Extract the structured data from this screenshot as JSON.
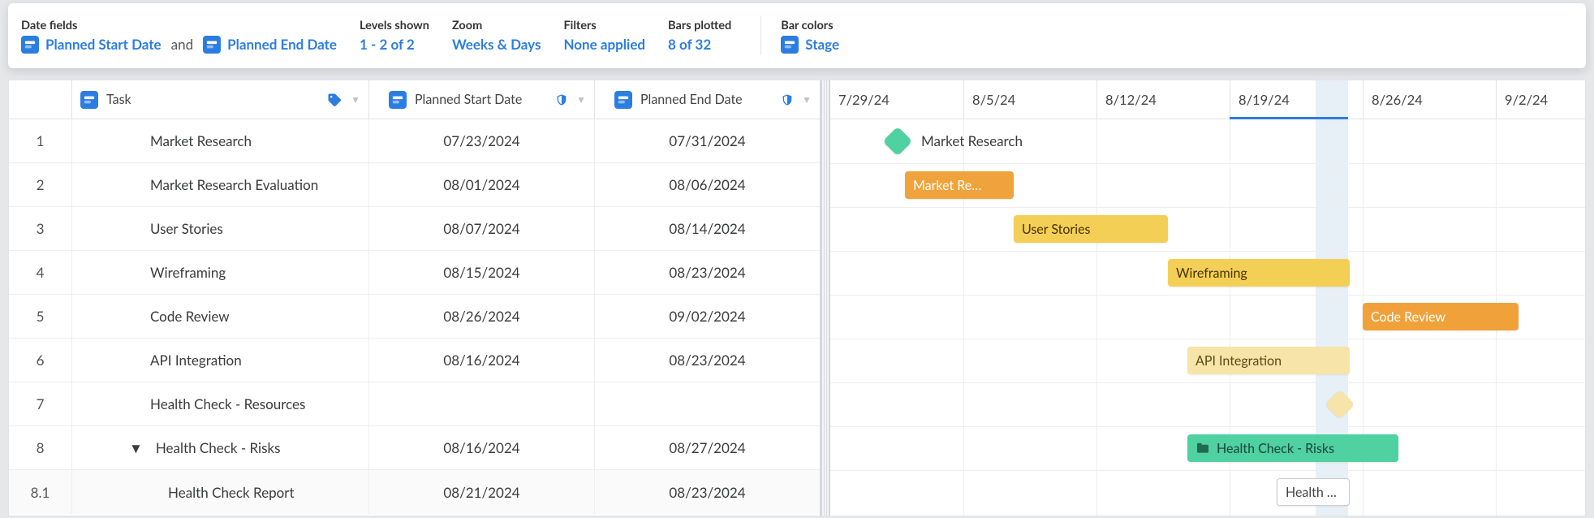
{
  "toolbar": {
    "date_fields": {
      "label": "Date fields",
      "start": "Planned Start Date",
      "and": "and",
      "end": "Planned End Date"
    },
    "levels": {
      "label": "Levels shown",
      "value": "1 - 2 of 2"
    },
    "zoom": {
      "label": "Zoom",
      "value": "Weeks & Days"
    },
    "filters": {
      "label": "Filters",
      "value": "None applied"
    },
    "bars": {
      "label": "Bars plotted",
      "value": "8 of 32"
    },
    "colors": {
      "label": "Bar colors",
      "value": "Stage"
    }
  },
  "columns": {
    "task": "Task",
    "start": "Planned Start Date",
    "end": "Planned End Date"
  },
  "timeline": {
    "ticks": [
      "7/29/24",
      "8/5/24",
      "8/12/24",
      "8/19/24",
      "8/26/24",
      "9/2/24"
    ]
  },
  "rows": [
    {
      "num": "1",
      "task": "Market Research",
      "start": "07/23/2024",
      "end": "07/31/2024",
      "indent": 0
    },
    {
      "num": "2",
      "task": "Market Research Evaluation",
      "start": "08/01/2024",
      "end": "08/06/2024",
      "indent": 0
    },
    {
      "num": "3",
      "task": "User Stories",
      "start": "08/07/2024",
      "end": "08/14/2024",
      "indent": 0
    },
    {
      "num": "4",
      "task": "Wireframing",
      "start": "08/15/2024",
      "end": "08/23/2024",
      "indent": 0
    },
    {
      "num": "5",
      "task": "Code Review",
      "start": "08/26/2024",
      "end": "09/02/2024",
      "indent": 0
    },
    {
      "num": "6",
      "task": "API Integration",
      "start": "08/16/2024",
      "end": "08/23/2024",
      "indent": 0
    },
    {
      "num": "7",
      "task": "Health Check - Resources",
      "start": "",
      "end": "",
      "indent": 0
    },
    {
      "num": "8",
      "task": "Health Check - Risks",
      "start": "08/16/2024",
      "end": "08/27/2024",
      "indent": 0,
      "expandable": true
    },
    {
      "num": "8.1",
      "task": "Health Check Report",
      "start": "08/21/2024",
      "end": "08/23/2024",
      "indent": 1
    }
  ],
  "bars": {
    "r1_label": "Market Research",
    "r2_label": "Market Re…",
    "r3_label": "User Stories",
    "r4_label": "Wireframing",
    "r5_label": "Code Review",
    "r6_label": "API Integration",
    "r8_label": "Health Check - Risks",
    "r9_label": "Health …"
  },
  "chart_data": {
    "type": "gantt",
    "date_origin": "2024-07-29",
    "ticks": [
      "2024-07-29",
      "2024-08-05",
      "2024-08-12",
      "2024-08-19",
      "2024-08-26",
      "2024-09-02"
    ],
    "today": "2024-08-22",
    "tasks": [
      {
        "row": 1,
        "name": "Market Research",
        "start": "2024-07-23",
        "end": "2024-07-31",
        "stage": "complete",
        "shape": "milestone"
      },
      {
        "row": 2,
        "name": "Market Research Evaluation",
        "start": "2024-08-01",
        "end": "2024-08-06",
        "stage": "orange"
      },
      {
        "row": 3,
        "name": "User Stories",
        "start": "2024-08-07",
        "end": "2024-08-14",
        "stage": "yellow"
      },
      {
        "row": 4,
        "name": "Wireframing",
        "start": "2024-08-15",
        "end": "2024-08-23",
        "stage": "yellow"
      },
      {
        "row": 5,
        "name": "Code Review",
        "start": "2024-08-26",
        "end": "2024-09-02",
        "stage": "orange"
      },
      {
        "row": 6,
        "name": "API Integration",
        "start": "2024-08-16",
        "end": "2024-08-23",
        "stage": "pale"
      },
      {
        "row": 7,
        "name": "Health Check - Resources",
        "start": "2024-08-22",
        "end": "2024-08-22",
        "stage": "pale",
        "shape": "milestone"
      },
      {
        "row": 8,
        "name": "Health Check - Risks",
        "start": "2024-08-16",
        "end": "2024-08-27",
        "stage": "green",
        "group": true
      },
      {
        "row": 8.1,
        "name": "Health Check Report",
        "start": "2024-08-21",
        "end": "2024-08-23",
        "stage": "outline"
      }
    ]
  }
}
